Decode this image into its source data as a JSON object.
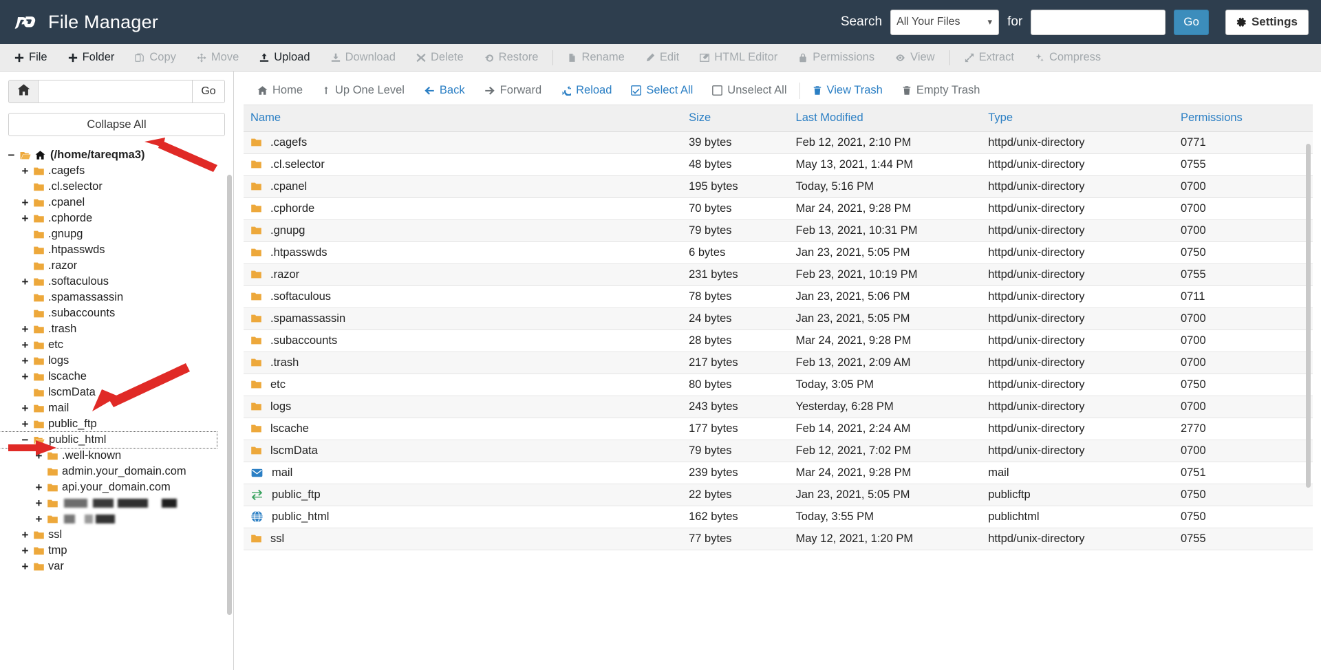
{
  "header": {
    "app_title": "File Manager",
    "logo_icon": "cpanel-logo-icon",
    "search_label": "Search",
    "search_scope": "All Your Files",
    "search_for_label": "for",
    "search_value": "",
    "search_placeholder": "",
    "go_label": "Go",
    "settings_label": "Settings",
    "settings_icon": "gear-icon",
    "bg_color": "#2e3e4e",
    "accent_color": "#3c8dbc"
  },
  "toolbar": {
    "items": [
      {
        "label": "File",
        "icon": "plus-icon",
        "disabled": false
      },
      {
        "label": "Folder",
        "icon": "plus-icon",
        "disabled": false
      },
      {
        "label": "Copy",
        "icon": "copy-icon",
        "disabled": true
      },
      {
        "label": "Move",
        "icon": "move-icon",
        "disabled": true
      },
      {
        "label": "Upload",
        "icon": "upload-icon",
        "disabled": false
      },
      {
        "label": "Download",
        "icon": "download-icon",
        "disabled": true
      },
      {
        "label": "Delete",
        "icon": "x-icon",
        "disabled": true
      },
      {
        "label": "Restore",
        "icon": "undo-icon",
        "disabled": true
      },
      {
        "label": "Rename",
        "icon": "file-icon",
        "disabled": true
      },
      {
        "label": "Edit",
        "icon": "pencil-icon",
        "disabled": true
      },
      {
        "label": "HTML Editor",
        "icon": "html-editor-icon",
        "disabled": true
      },
      {
        "label": "Permissions",
        "icon": "lock-icon",
        "disabled": true
      },
      {
        "label": "View",
        "icon": "eye-icon",
        "disabled": true
      },
      {
        "label": "Extract",
        "icon": "extract-icon",
        "disabled": true
      },
      {
        "label": "Compress",
        "icon": "compress-icon",
        "disabled": true
      }
    ],
    "separator_after": [
      7,
      12
    ]
  },
  "sidebar": {
    "home_icon": "home-icon",
    "path_value": "",
    "go_label": "Go",
    "collapse_all_label": "Collapse All",
    "tree": [
      {
        "label": "(/home/tareqma3)",
        "depth": 0,
        "toggle": "minus",
        "icon": "open-folder-home-icon",
        "bold": true
      },
      {
        "label": ".cagefs",
        "depth": 1,
        "toggle": "plus",
        "icon": "folder-icon"
      },
      {
        "label": ".cl.selector",
        "depth": 1,
        "toggle": "none",
        "icon": "folder-icon"
      },
      {
        "label": ".cpanel",
        "depth": 1,
        "toggle": "plus",
        "icon": "folder-icon"
      },
      {
        "label": ".cphorde",
        "depth": 1,
        "toggle": "plus",
        "icon": "folder-icon"
      },
      {
        "label": ".gnupg",
        "depth": 1,
        "toggle": "none",
        "icon": "folder-icon"
      },
      {
        "label": ".htpasswds",
        "depth": 1,
        "toggle": "none",
        "icon": "folder-icon"
      },
      {
        "label": ".razor",
        "depth": 1,
        "toggle": "none",
        "icon": "folder-icon"
      },
      {
        "label": ".softaculous",
        "depth": 1,
        "toggle": "plus",
        "icon": "folder-icon"
      },
      {
        "label": ".spamassassin",
        "depth": 1,
        "toggle": "none",
        "icon": "folder-icon"
      },
      {
        "label": ".subaccounts",
        "depth": 1,
        "toggle": "none",
        "icon": "folder-icon"
      },
      {
        "label": ".trash",
        "depth": 1,
        "toggle": "plus",
        "icon": "folder-icon"
      },
      {
        "label": "etc",
        "depth": 1,
        "toggle": "plus",
        "icon": "folder-icon"
      },
      {
        "label": "logs",
        "depth": 1,
        "toggle": "plus",
        "icon": "folder-icon"
      },
      {
        "label": "lscache",
        "depth": 1,
        "toggle": "plus",
        "icon": "folder-icon"
      },
      {
        "label": "lscmData",
        "depth": 1,
        "toggle": "none",
        "icon": "folder-icon"
      },
      {
        "label": "mail",
        "depth": 1,
        "toggle": "plus",
        "icon": "folder-icon"
      },
      {
        "label": "public_ftp",
        "depth": 1,
        "toggle": "plus",
        "icon": "folder-icon"
      },
      {
        "label": "public_html",
        "depth": 1,
        "toggle": "minus",
        "icon": "open-folder-icon",
        "focused": true
      },
      {
        "label": ".well-known",
        "depth": 2,
        "toggle": "plus",
        "icon": "folder-icon"
      },
      {
        "label": "admin.your_domain.com",
        "depth": 2,
        "toggle": "none",
        "icon": "folder-icon"
      },
      {
        "label": "api.your_domain.com",
        "depth": 2,
        "toggle": "plus",
        "icon": "folder-icon"
      },
      {
        "label": "",
        "depth": 2,
        "toggle": "plus",
        "icon": "folder-icon",
        "redacted": "wide"
      },
      {
        "label": "",
        "depth": 2,
        "toggle": "plus",
        "icon": "folder-icon",
        "redacted": "narrow"
      },
      {
        "label": "ssl",
        "depth": 1,
        "toggle": "plus",
        "icon": "folder-icon"
      },
      {
        "label": "tmp",
        "depth": 1,
        "toggle": "plus",
        "icon": "folder-icon"
      },
      {
        "label": "var",
        "depth": 1,
        "toggle": "plus",
        "icon": "folder-icon"
      }
    ]
  },
  "filenav": {
    "items": [
      {
        "label": "Home",
        "icon": "home-icon",
        "active": false
      },
      {
        "label": "Up One Level",
        "icon": "up-arrow-icon",
        "active": false
      },
      {
        "label": "Back",
        "icon": "arrow-left-icon",
        "active": true
      },
      {
        "label": "Forward",
        "icon": "arrow-right-icon",
        "active": false
      },
      {
        "label": "Reload",
        "icon": "reload-icon",
        "active": true
      },
      {
        "label": "Select All",
        "icon": "checkbox-checked-icon",
        "active": true
      },
      {
        "label": "Unselect All",
        "icon": "checkbox-empty-icon",
        "active": false
      },
      {
        "label": "View Trash",
        "icon": "trash-icon",
        "active": true
      },
      {
        "label": "Empty Trash",
        "icon": "trash-icon",
        "active": false
      }
    ],
    "separator_after": [
      6
    ]
  },
  "filetable": {
    "columns": [
      "Name",
      "Size",
      "Last Modified",
      "Type",
      "Permissions"
    ],
    "rows": [
      {
        "name": ".cagefs",
        "icon": "folder-icon",
        "size": "39 bytes",
        "modified": "Feb 12, 2021, 2:10 PM",
        "type": "httpd/unix-directory",
        "perms": "0771"
      },
      {
        "name": ".cl.selector",
        "icon": "folder-icon",
        "size": "48 bytes",
        "modified": "May 13, 2021, 1:44 PM",
        "type": "httpd/unix-directory",
        "perms": "0755"
      },
      {
        "name": ".cpanel",
        "icon": "folder-icon",
        "size": "195 bytes",
        "modified": "Today, 5:16 PM",
        "type": "httpd/unix-directory",
        "perms": "0700"
      },
      {
        "name": ".cphorde",
        "icon": "folder-icon",
        "size": "70 bytes",
        "modified": "Mar 24, 2021, 9:28 PM",
        "type": "httpd/unix-directory",
        "perms": "0700"
      },
      {
        "name": ".gnupg",
        "icon": "folder-icon",
        "size": "79 bytes",
        "modified": "Feb 13, 2021, 10:31 PM",
        "type": "httpd/unix-directory",
        "perms": "0700"
      },
      {
        "name": ".htpasswds",
        "icon": "folder-icon",
        "size": "6 bytes",
        "modified": "Jan 23, 2021, 5:05 PM",
        "type": "httpd/unix-directory",
        "perms": "0750"
      },
      {
        "name": ".razor",
        "icon": "folder-icon",
        "size": "231 bytes",
        "modified": "Feb 23, 2021, 10:19 PM",
        "type": "httpd/unix-directory",
        "perms": "0755"
      },
      {
        "name": ".softaculous",
        "icon": "folder-icon",
        "size": "78 bytes",
        "modified": "Jan 23, 2021, 5:06 PM",
        "type": "httpd/unix-directory",
        "perms": "0711"
      },
      {
        "name": ".spamassassin",
        "icon": "folder-icon",
        "size": "24 bytes",
        "modified": "Jan 23, 2021, 5:05 PM",
        "type": "httpd/unix-directory",
        "perms": "0700"
      },
      {
        "name": ".subaccounts",
        "icon": "folder-icon",
        "size": "28 bytes",
        "modified": "Mar 24, 2021, 9:28 PM",
        "type": "httpd/unix-directory",
        "perms": "0700"
      },
      {
        "name": ".trash",
        "icon": "folder-icon",
        "size": "217 bytes",
        "modified": "Feb 13, 2021, 2:09 AM",
        "type": "httpd/unix-directory",
        "perms": "0700"
      },
      {
        "name": "etc",
        "icon": "folder-icon",
        "size": "80 bytes",
        "modified": "Today, 3:05 PM",
        "type": "httpd/unix-directory",
        "perms": "0750"
      },
      {
        "name": "logs",
        "icon": "folder-icon",
        "size": "243 bytes",
        "modified": "Yesterday, 6:28 PM",
        "type": "httpd/unix-directory",
        "perms": "0700"
      },
      {
        "name": "lscache",
        "icon": "folder-icon",
        "size": "177 bytes",
        "modified": "Feb 14, 2021, 2:24 AM",
        "type": "httpd/unix-directory",
        "perms": "2770"
      },
      {
        "name": "lscmData",
        "icon": "folder-icon",
        "size": "79 bytes",
        "modified": "Feb 12, 2021, 7:02 PM",
        "type": "httpd/unix-directory",
        "perms": "0700"
      },
      {
        "name": "mail",
        "icon": "envelope-icon",
        "size": "239 bytes",
        "modified": "Mar 24, 2021, 9:28 PM",
        "type": "mail",
        "perms": "0751"
      },
      {
        "name": "public_ftp",
        "icon": "ftp-icon",
        "size": "22 bytes",
        "modified": "Jan 23, 2021, 5:05 PM",
        "type": "publicftp",
        "perms": "0750"
      },
      {
        "name": "public_html",
        "icon": "globe-icon",
        "size": "162 bytes",
        "modified": "Today, 3:55 PM",
        "type": "publichtml",
        "perms": "0750"
      },
      {
        "name": "ssl",
        "icon": "folder-icon",
        "size": "77 bytes",
        "modified": "May 12, 2021, 1:20 PM",
        "type": "httpd/unix-directory",
        "perms": "0755"
      }
    ]
  },
  "annotations": {
    "arrow_color": "#e02a26",
    "arrows": [
      {
        "name": "arrow-pointing-to-home-path"
      },
      {
        "name": "arrow-pointing-to-public-html"
      },
      {
        "name": "arrow-pointing-to-admin-subdomain"
      }
    ]
  }
}
